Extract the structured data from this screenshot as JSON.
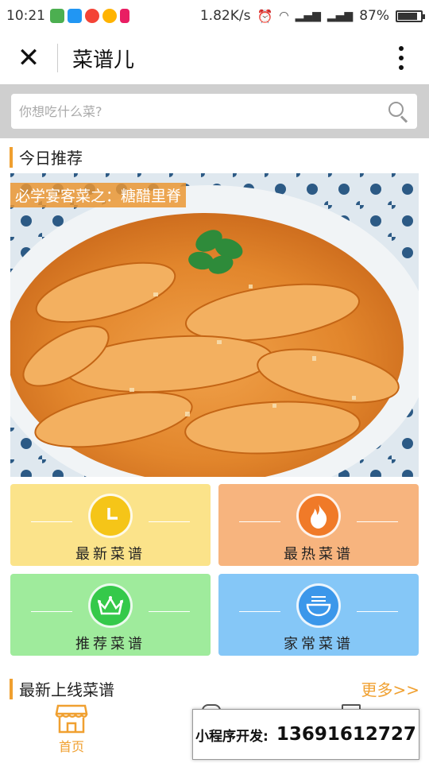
{
  "status_bar": {
    "time": "10:21",
    "network_speed": "1.82K/s",
    "battery": "87%",
    "battery_level": 0.87
  },
  "title_bar": {
    "title": "菜谱儿"
  },
  "search": {
    "placeholder": "你想吃什么菜?"
  },
  "today": {
    "section_title": "今日推荐",
    "featured_caption": "必学宴客菜之：糖醋里脊"
  },
  "categories": [
    {
      "label": "最新菜谱",
      "icon": "clock-icon",
      "bg": "#fbe38a",
      "circle": "#f5c518"
    },
    {
      "label": "最热菜谱",
      "icon": "fire-icon",
      "bg": "#f7b47e",
      "circle": "#f07a28"
    },
    {
      "label": "推荐菜谱",
      "icon": "crown-icon",
      "bg": "#9feb9c",
      "circle": "#35c94a"
    },
    {
      "label": "家常菜谱",
      "icon": "bowl-icon",
      "bg": "#85c7f7",
      "circle": "#3b97ea"
    }
  ],
  "latest": {
    "section_title": "最新上线菜谱",
    "more_label": "更多>>"
  },
  "tab_bar": {
    "home_label": "首页"
  },
  "promo": {
    "label": "小程序开发:",
    "phone": "13691612727"
  },
  "colors": {
    "accent": "#f0a030"
  }
}
